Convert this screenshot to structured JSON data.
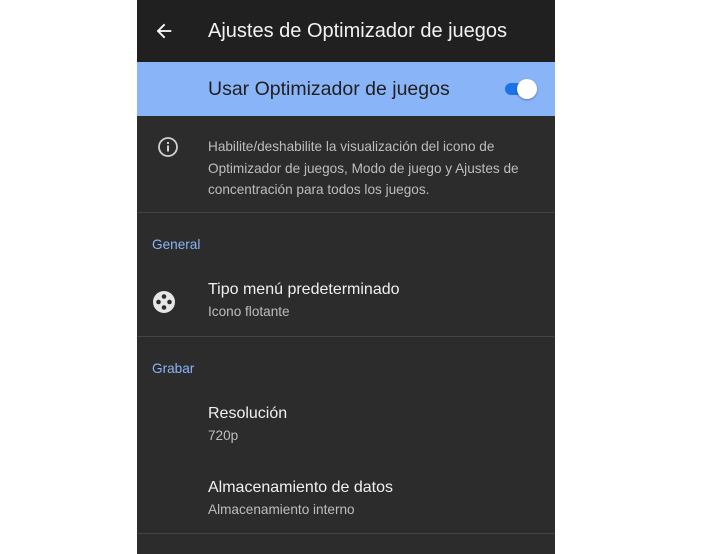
{
  "appbar": {
    "title": "Ajustes de Optimizador de juegos",
    "back_icon": "arrow-left-icon"
  },
  "master_switch": {
    "label": "Usar Optimizador de juegos",
    "enabled": true,
    "accent": "#8ab4f8",
    "track_color": "#1a73e8"
  },
  "info": {
    "icon": "info-icon",
    "text": "Habilite/deshabilite la visualización del icono de Optimizador de juegos, Modo de juego y Ajustes de concentración para todos los juegos."
  },
  "sections": {
    "general": {
      "header": "General",
      "items": [
        {
          "icon": "gamepad-icon",
          "title": "Tipo menú predeterminado",
          "summary": "Icono flotante"
        }
      ]
    },
    "grabar": {
      "header": "Grabar",
      "items": [
        {
          "title": "Resolución",
          "summary": "720p"
        },
        {
          "title": "Almacenamiento de datos",
          "summary": "Almacenamiento interno"
        }
      ]
    }
  }
}
